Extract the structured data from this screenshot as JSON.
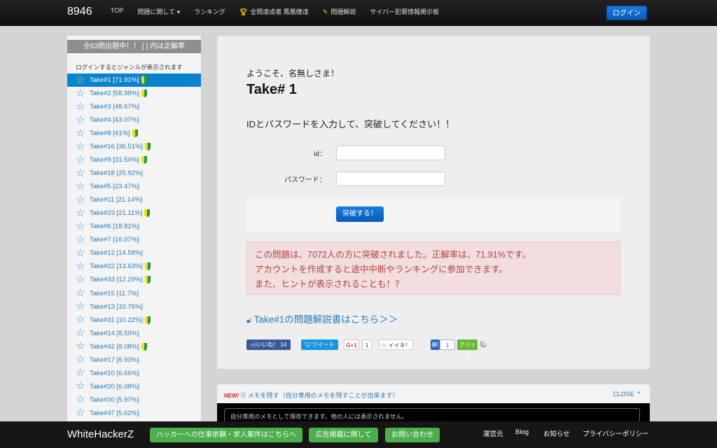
{
  "header": {
    "brand": "8946",
    "nav": [
      "TOP",
      "問題に関して ▾",
      "ランキング",
      "全問達成者 鳳凰棲達",
      "問題解説",
      "サイバー犯罪情報掲示板"
    ],
    "login": "ログイン"
  },
  "sidebar": {
    "heading": "全63問出題中！！ [ ] 内は正解率",
    "note": "ログインするとジャンルが表示されます",
    "items": [
      {
        "label": "Take#1 [71.91%]",
        "beginner": true,
        "active": true
      },
      {
        "label": "Take#2 [58.98%]",
        "beginner": true
      },
      {
        "label": "Take#3 [48.67%]",
        "beginner": false
      },
      {
        "label": "Take#4 [43.07%]",
        "beginner": false
      },
      {
        "label": "Take#8 [41%]",
        "beginner": true
      },
      {
        "label": "Take#16 [36.51%]",
        "beginner": true
      },
      {
        "label": "Take#9 [31.54%]",
        "beginner": true
      },
      {
        "label": "Take#18 [25.92%]",
        "beginner": false
      },
      {
        "label": "Take#5 [23.47%]",
        "beginner": false
      },
      {
        "label": "Take#11 [21.14%]",
        "beginner": false
      },
      {
        "label": "Take#23 [21.11%]",
        "beginner": true
      },
      {
        "label": "Take#6 [18.81%]",
        "beginner": false
      },
      {
        "label": "Take#7 [16.07%]",
        "beginner": false
      },
      {
        "label": "Take#12 [14.58%]",
        "beginner": false
      },
      {
        "label": "Take#22 [13.63%]",
        "beginner": true
      },
      {
        "label": "Take#33 [12.29%]",
        "beginner": true
      },
      {
        "label": "Take#15 [11.7%]",
        "beginner": false
      },
      {
        "label": "Take#13 [10.76%]",
        "beginner": false
      },
      {
        "label": "Take#31 [10.22%]",
        "beginner": true
      },
      {
        "label": "Take#14 [8.59%]",
        "beginner": false
      },
      {
        "label": "Take#42 [8.08%]",
        "beginner": true
      },
      {
        "label": "Take#17 [6.93%]",
        "beginner": false
      },
      {
        "label": "Take#10 [6.66%]",
        "beginner": false
      },
      {
        "label": "Take#20 [6.08%]",
        "beginner": false
      },
      {
        "label": "Take#30 [5.97%]",
        "beginner": false
      },
      {
        "label": "Take#47 [5.62%]",
        "beginner": false
      }
    ]
  },
  "main": {
    "welcome": "ようこそ、名無しさま！",
    "title": "Take# 1",
    "instruction": "IDとパスワードを入力して、突破してください！！",
    "id_label": "id：",
    "password_label": "パスワード：",
    "submit": "突破する！",
    "alert": [
      "この問題は、7072人の方に突破されました。正解率は、71.91%です。",
      "アカウントを作成すると途中中断やランキングに参加できます。",
      "また、ヒントが表示されることも！？"
    ],
    "solution_link": "Take#1の問題解説書はこちら＞＞",
    "share": {
      "like": "いいね！",
      "like_count": "14",
      "tweet": "ツイート",
      "gplus": "G+1",
      "gplus_count": "1",
      "mixi": "イイネ！",
      "hatena": "B!",
      "hatena_count": "1",
      "clip": "クリップ"
    }
  },
  "memo": {
    "new": "NEW!",
    "title": "メモを残す（自分専用のメモを残すことが出来ます）",
    "close": "CLOSE",
    "placeholder": "自分専用のメモとして保存できます。他の人には表示されません。"
  },
  "footer": {
    "brand": "WhiteHackerZ",
    "buttons": [
      "ハッカーへの仕事依頼・求人案件はこちらへ",
      "広告掲載に関して",
      "お問い合わせ"
    ],
    "links": [
      "運営元",
      "Blog",
      "お知らせ",
      "プライバシーポリシー"
    ]
  }
}
